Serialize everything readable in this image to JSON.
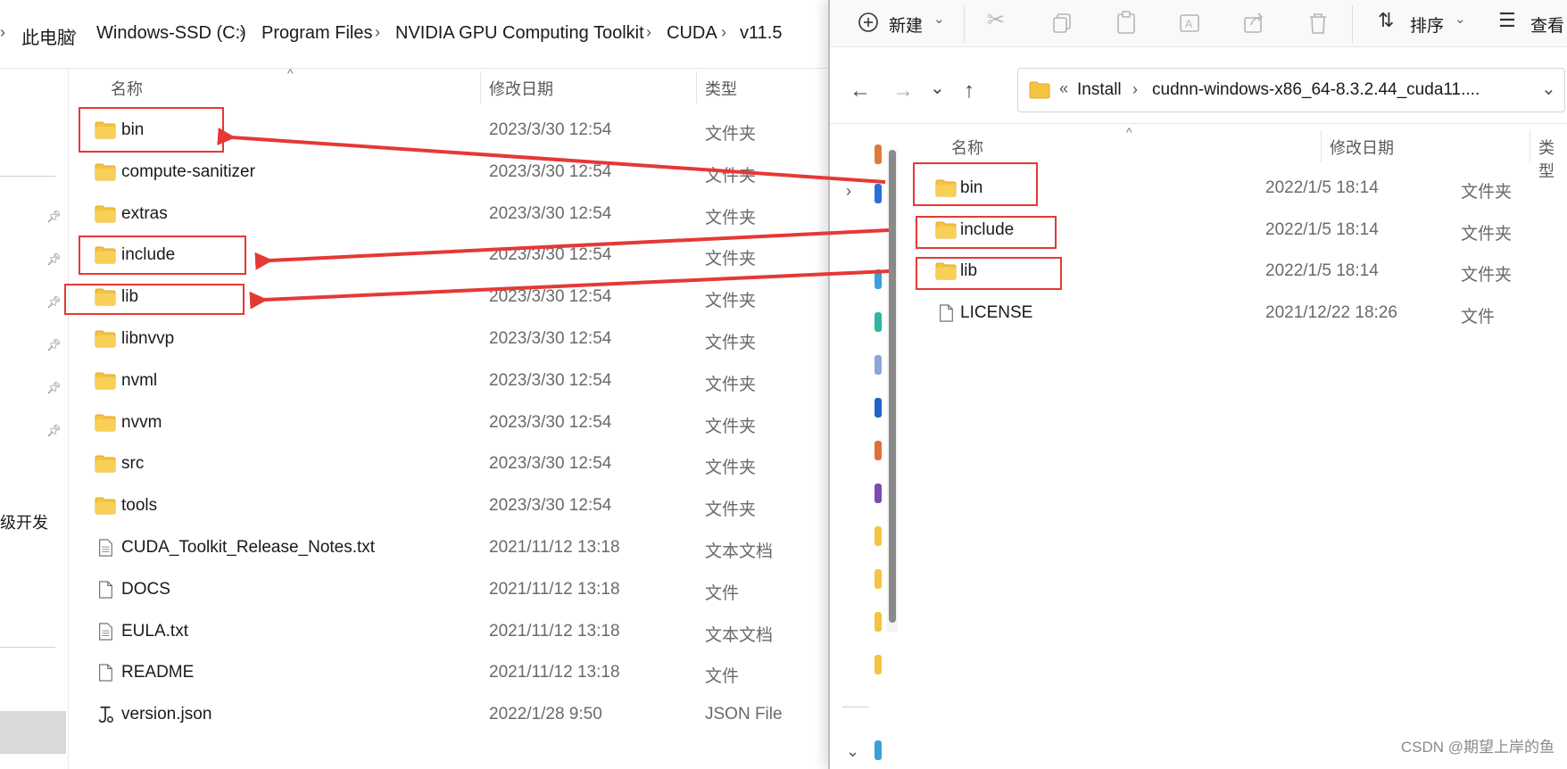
{
  "left": {
    "breadcrumb": [
      "此电脑",
      "Windows-SSD (C:)",
      "Program Files",
      "NVIDIA GPU Computing Toolkit",
      "CUDA",
      "v11.5"
    ],
    "nav_partial_text": "级开发",
    "columns": {
      "name": "名称",
      "date": "修改日期",
      "type": "类型"
    },
    "rows": [
      {
        "name": "bin",
        "date": "2023/3/30 12:54",
        "type": "文件夹",
        "icon": "folder"
      },
      {
        "name": "compute-sanitizer",
        "date": "2023/3/30 12:54",
        "type": "文件夹",
        "icon": "folder"
      },
      {
        "name": "extras",
        "date": "2023/3/30 12:54",
        "type": "文件夹",
        "icon": "folder"
      },
      {
        "name": "include",
        "date": "2023/3/30 12:54",
        "type": "文件夹",
        "icon": "folder"
      },
      {
        "name": "lib",
        "date": "2023/3/30 12:54",
        "type": "文件夹",
        "icon": "folder"
      },
      {
        "name": "libnvvp",
        "date": "2023/3/30 12:54",
        "type": "文件夹",
        "icon": "folder"
      },
      {
        "name": "nvml",
        "date": "2023/3/30 12:54",
        "type": "文件夹",
        "icon": "folder"
      },
      {
        "name": "nvvm",
        "date": "2023/3/30 12:54",
        "type": "文件夹",
        "icon": "folder"
      },
      {
        "name": "src",
        "date": "2023/3/30 12:54",
        "type": "文件夹",
        "icon": "folder"
      },
      {
        "name": "tools",
        "date": "2023/3/30 12:54",
        "type": "文件夹",
        "icon": "folder"
      },
      {
        "name": "CUDA_Toolkit_Release_Notes.txt",
        "date": "2021/11/12 13:18",
        "type": "文本文档",
        "icon": "text"
      },
      {
        "name": "DOCS",
        "date": "2021/11/12 13:18",
        "type": "文件",
        "icon": "file"
      },
      {
        "name": "EULA.txt",
        "date": "2021/11/12 13:18",
        "type": "文本文档",
        "icon": "text"
      },
      {
        "name": "README",
        "date": "2021/11/12 13:18",
        "type": "文件",
        "icon": "file"
      },
      {
        "name": "version.json",
        "date": "2022/1/28 9:50",
        "type": "JSON File",
        "icon": "json"
      }
    ]
  },
  "right": {
    "toolbar": {
      "new_label": "新建",
      "sort_label": "排序",
      "view_label": "查看"
    },
    "address": {
      "prefix": "«",
      "path": [
        "Install",
        "cudnn-windows-x86_64-8.3.2.44_cuda11...."
      ]
    },
    "columns": {
      "name": "名称",
      "date": "修改日期",
      "type": "类型"
    },
    "rows": [
      {
        "name": "bin",
        "date": "2022/1/5 18:14",
        "type": "文件夹",
        "icon": "folder"
      },
      {
        "name": "include",
        "date": "2022/1/5 18:14",
        "type": "文件夹",
        "icon": "folder"
      },
      {
        "name": "lib",
        "date": "2022/1/5 18:14",
        "type": "文件夹",
        "icon": "folder"
      },
      {
        "name": "LICENSE",
        "date": "2021/12/22 18:26",
        "type": "文件",
        "icon": "file"
      }
    ]
  },
  "watermark": "CSDN @期望上岸的鱼",
  "colors": {
    "highlight": "#e53935",
    "folder": "#f5c342",
    "folder_dark": "#e0a92a"
  }
}
